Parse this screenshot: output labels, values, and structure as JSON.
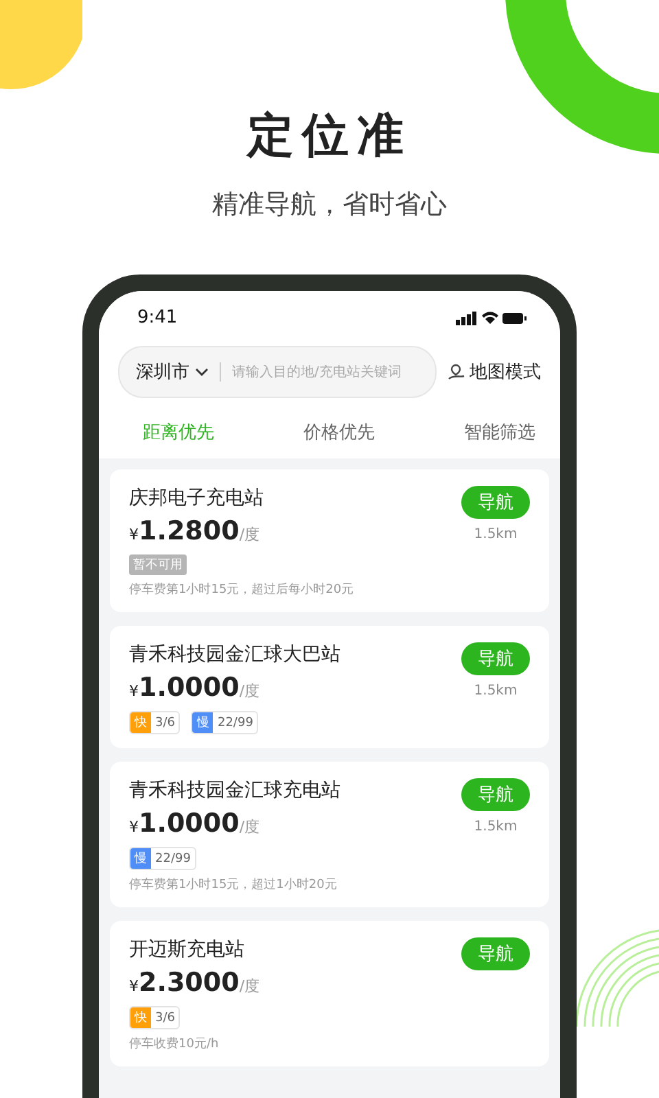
{
  "headline": "定位准",
  "subheadline": "精准导航，省时省心",
  "phone": {
    "status_bar": {
      "time": "9:41"
    },
    "search": {
      "city": "深圳市",
      "placeholder": "请输入目的地/充电站关键词"
    },
    "map_mode": "地图模式",
    "tabs": [
      {
        "label": "距离优先",
        "selected": true
      },
      {
        "label": "价格优先",
        "selected": false
      },
      {
        "label": "智能筛选",
        "selected": false
      }
    ],
    "stations": [
      {
        "name": "庆邦电子充电站",
        "currency": "¥",
        "price": "1.2800",
        "unit": "/度",
        "nav": "导航",
        "distance": "1.5km",
        "tags": [
          {
            "kind": "status",
            "label": "暂不可用"
          }
        ],
        "note": "停车费第1小时15元，超过后每小时20元"
      },
      {
        "name": "青禾科技园金汇球大巴站",
        "currency": "¥",
        "price": "1.0000",
        "unit": "/度",
        "nav": "导航",
        "distance": "1.5km",
        "tags": [
          {
            "kind": "fast",
            "label": "快",
            "count": "3/6"
          },
          {
            "kind": "slow",
            "label": "慢",
            "count": "22/99"
          }
        ]
      },
      {
        "name": "青禾科技园金汇球充电站",
        "currency": "¥",
        "price": "1.0000",
        "unit": "/度",
        "nav": "导航",
        "distance": "1.5km",
        "tags": [
          {
            "kind": "slow",
            "label": "慢",
            "count": "22/99"
          }
        ],
        "note": "停车费第1小时15元，超过1小时20元"
      },
      {
        "name": "开迈斯充电站",
        "currency": "¥",
        "price": "2.3000",
        "unit": "/度",
        "nav": "导航",
        "tags": [
          {
            "kind": "fast",
            "label": "快",
            "count": "3/6"
          }
        ],
        "note": "停车收费10元/h"
      }
    ]
  }
}
